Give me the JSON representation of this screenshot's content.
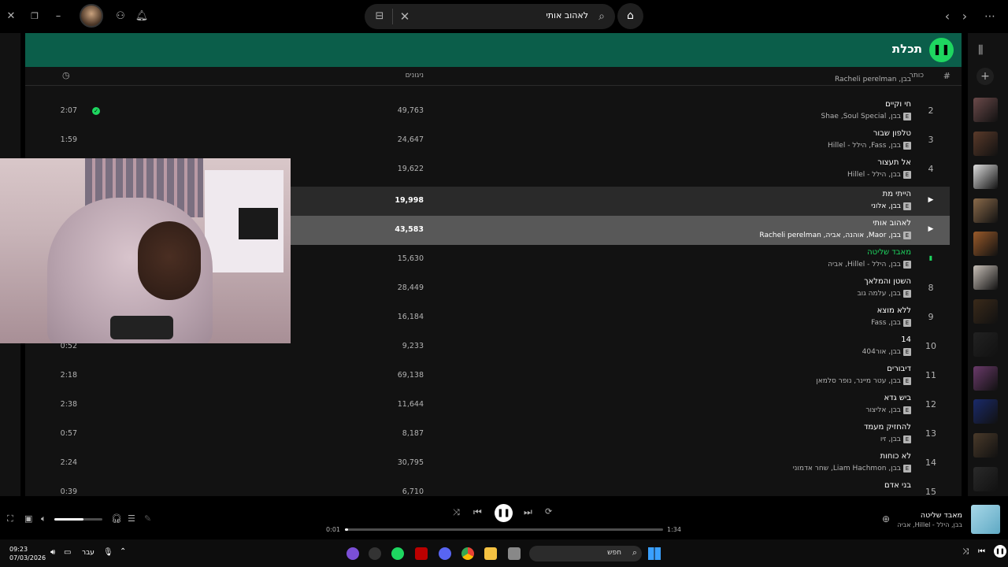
{
  "window": {
    "search_query": "לאהוב אותי"
  },
  "playlist": {
    "title": "תכלת",
    "columns": {
      "num": "#",
      "title": "כותר",
      "plays": "ניגונים"
    },
    "rows": [
      {
        "num": "",
        "title": "",
        "artist": "בבן, Racheli perelman",
        "plays": "",
        "duration": "",
        "state": "partial"
      },
      {
        "num": "2",
        "title": "חי וקיים",
        "artist": "בבן, Shae ,Soul Special",
        "plays": "49,763",
        "duration": "2:07",
        "state": "saved"
      },
      {
        "num": "3",
        "title": "טלפון שבור",
        "artist": "בבן, Fass, הילל - Hillel",
        "plays": "24,647",
        "duration": "1:59",
        "state": ""
      },
      {
        "num": "4",
        "title": "אל תעצור",
        "artist": "בבן, הילל - Hillel",
        "plays": "19,622",
        "duration": "",
        "state": ""
      },
      {
        "num": "",
        "title": "הייתי מת",
        "artist": "בבן, אלוני",
        "plays": "19,998",
        "duration": "",
        "state": "hover"
      },
      {
        "num": "",
        "title": "לאהוב אותי",
        "artist": "בבן, Maor, אוהנה, אביה, Racheli perelman",
        "plays": "43,583",
        "duration": "",
        "state": "selected"
      },
      {
        "num": "",
        "title": "מאבד שליטה",
        "artist": "בבן, הילל - Hillel, אביה",
        "plays": "15,630",
        "duration": "",
        "state": "playing"
      },
      {
        "num": "8",
        "title": "השטן והמלאך",
        "artist": "בבן, עלמה גוב",
        "plays": "28,449",
        "duration": "",
        "state": ""
      },
      {
        "num": "9",
        "title": "ללא מוצא",
        "artist": "בבן, Fass",
        "plays": "16,184",
        "duration": "",
        "state": ""
      },
      {
        "num": "10",
        "title": "14",
        "artist": "בבן, אור404",
        "plays": "9,233",
        "duration": "0:52",
        "state": ""
      },
      {
        "num": "11",
        "title": "דיבורים",
        "artist": "בבן, עטר מיינר, נופר סלמאן",
        "plays": "69,138",
        "duration": "2:18",
        "state": ""
      },
      {
        "num": "12",
        "title": "ביש גדא",
        "artist": "בבן, אליצור",
        "plays": "11,644",
        "duration": "2:38",
        "state": ""
      },
      {
        "num": "13",
        "title": "להחזיק מעמד",
        "artist": "בבן, זיו",
        "plays": "8,187",
        "duration": "0:57",
        "state": ""
      },
      {
        "num": "14",
        "title": "לא כוחות",
        "artist": "בבן, Liam Hachmon, שחר אדמוני",
        "plays": "30,795",
        "duration": "2:24",
        "state": ""
      },
      {
        "num": "15",
        "title": "בני אדם",
        "artist": "",
        "plays": "6,710",
        "duration": "0:39",
        "state": ""
      }
    ]
  },
  "player": {
    "track_title": "מאבד שליטה",
    "track_artist": "בבן, הילל - Hillel, אביה",
    "elapsed": "0:01",
    "total": "1:34",
    "progress_fraction": 0.01,
    "volume_fraction": 0.6
  },
  "taskbar": {
    "time": "09:23",
    "date": "07/03/2026",
    "lang": "עבר",
    "search_placeholder": "חפש"
  },
  "colors": {
    "accent": "#1ed760",
    "header": "#0b5e4a"
  }
}
